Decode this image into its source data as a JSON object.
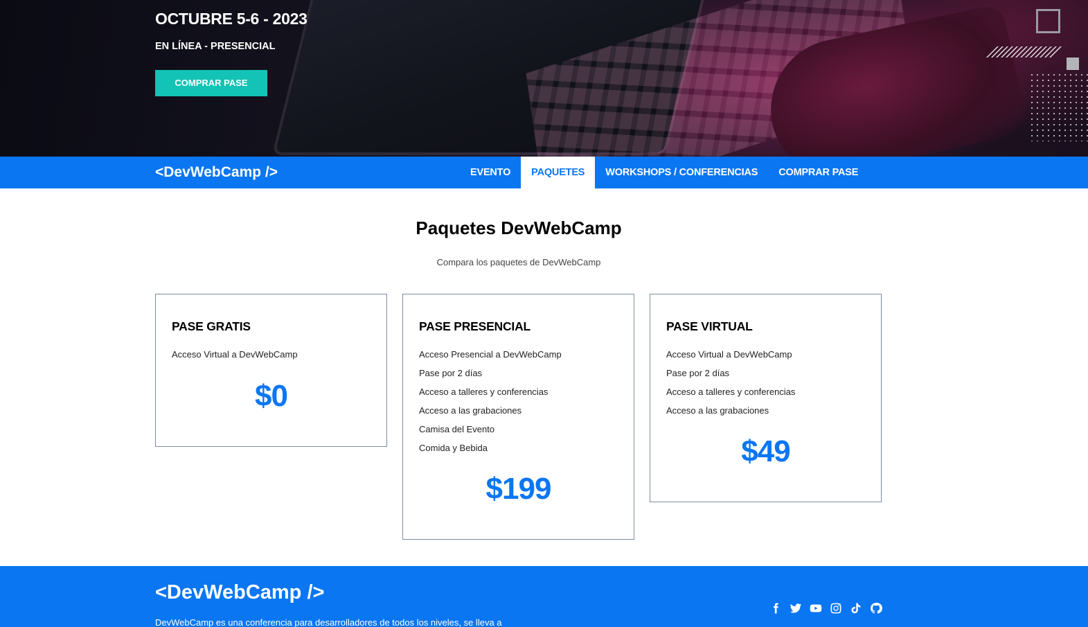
{
  "hero": {
    "date": "OCTUBRE 5-6 - 2023",
    "mode": "EN LÍNEA - PRESENCIAL",
    "cta_label": "COMPRAR PASE"
  },
  "nav": {
    "logo": "<DevWebCamp />",
    "links": [
      {
        "label": "EVENTO",
        "active": false
      },
      {
        "label": "PAQUETES",
        "active": true
      },
      {
        "label": "WORKSHOPS / CONFERENCIAS",
        "active": false
      },
      {
        "label": "COMPRAR PASE",
        "active": false
      }
    ]
  },
  "main": {
    "title": "Paquetes DevWebCamp",
    "subtitle": "Compara los paquetes de DevWebCamp"
  },
  "packages": [
    {
      "title": "PASE GRATIS",
      "features": [
        "Acceso Virtual a DevWebCamp"
      ],
      "price": "$0"
    },
    {
      "title": "PASE PRESENCIAL",
      "features": [
        "Acceso Presencial a DevWebCamp",
        "Pase por 2 días",
        "Acceso a talleres y conferencias",
        "Acceso a las grabaciones",
        "Camisa del Evento",
        "Comida y Bebida"
      ],
      "price": "$199"
    },
    {
      "title": "PASE VIRTUAL",
      "features": [
        "Acceso Virtual a DevWebCamp",
        "Pase por 2 días",
        "Acceso a talleres y conferencias",
        "Acceso a las grabaciones"
      ],
      "price": "$49"
    }
  ],
  "footer": {
    "logo": "<DevWebCamp />",
    "description": "DevWebCamp es una conferencia para desarrolladores de todos los niveles, se lleva a",
    "socials": [
      "facebook-icon",
      "twitter-icon",
      "youtube-icon",
      "instagram-icon",
      "tiktok-icon",
      "github-icon"
    ]
  },
  "colors": {
    "brand_blue": "#0a76f2",
    "accent_teal": "#13c3b5"
  }
}
